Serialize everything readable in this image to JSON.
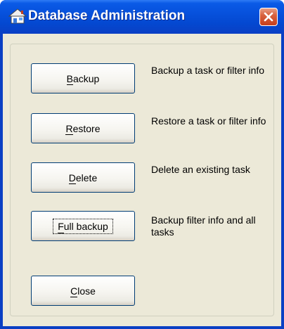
{
  "window": {
    "title": "Database Administration",
    "title_color": "#ffffff",
    "titlebar_color": "#0751dc",
    "close_color": "#d8623e",
    "app_icon": "house-icon",
    "close_icon": "close-icon"
  },
  "actions": [
    {
      "id": "backup",
      "label": "Backup",
      "mnemonic": "B",
      "description": "Backup a task or filter info",
      "focused": false
    },
    {
      "id": "restore",
      "label": "Restore",
      "mnemonic": "R",
      "description": "Restore a task or filter info",
      "focused": false
    },
    {
      "id": "delete",
      "label": "Delete",
      "mnemonic": "D",
      "description": "Delete an existing task",
      "focused": false
    },
    {
      "id": "full-backup",
      "label": "Full backup",
      "mnemonic": "F",
      "description": "Backup filter info and all tasks",
      "focused": true
    }
  ],
  "close_button": {
    "label": "Close",
    "mnemonic": "C"
  }
}
